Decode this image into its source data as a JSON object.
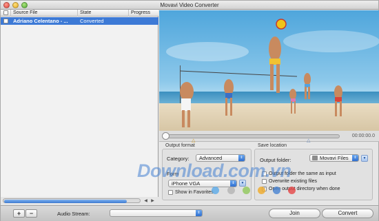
{
  "window": {
    "title": "Movavi Video Converter"
  },
  "filelist": {
    "columns": [
      "Source File",
      "State",
      "Progress"
    ],
    "rows": [
      {
        "name": "Adriano Celentano - ...",
        "state": "Converted",
        "progress": ""
      }
    ]
  },
  "player": {
    "time": "00:00:00.0",
    "position": 0.0
  },
  "output_format": {
    "heading": "Output format",
    "category_label": "Category:",
    "category_value": "Advanced",
    "format_label": "Form",
    "format_value": "iPhone VGA",
    "show_in_favorites": "Show in Favorites"
  },
  "save_location": {
    "heading": "Save location",
    "folder_label": "Output folder:",
    "folder_value": "Movavi Files",
    "options": [
      {
        "label": "Output folder the same as input",
        "checked": false
      },
      {
        "label": "Overwrite existing files",
        "checked": false
      },
      {
        "label": "Open output directory when done",
        "checked": true
      }
    ]
  },
  "watermark": "Download.com.vn",
  "bottom": {
    "add": "+",
    "remove": "−",
    "audio_label": "Audio Stream:",
    "audio_value": "",
    "join": "Join",
    "convert": "Convert"
  },
  "colors": {
    "selection": "#3d7ad6",
    "accent": "#2f6fd0"
  }
}
